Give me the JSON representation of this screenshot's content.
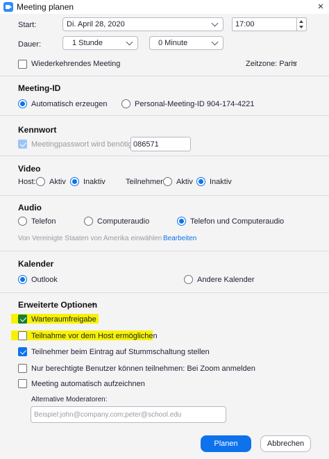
{
  "window": {
    "title": "Meeting planen",
    "close": "×"
  },
  "start": {
    "label": "Start:",
    "date": "Di.  April 28, 2020",
    "time": "17:00"
  },
  "duration": {
    "label": "Dauer:",
    "hours": "1 Stunde",
    "minutes": "0 Minute"
  },
  "recurring": {
    "label": "Wiederkehrendes Meeting",
    "checked": false
  },
  "timezone": {
    "label": "Zeitzone: Paris"
  },
  "meeting_id": {
    "title": "Meeting-ID",
    "auto": "Automatisch erzeugen",
    "personal": "Personal-Meeting-ID 904-174-4221",
    "selected": "auto"
  },
  "password": {
    "title": "Kennwort",
    "required_label": "Meetingpasswort wird benötigt",
    "value": "086571"
  },
  "video": {
    "title": "Video",
    "host_label": "Host:",
    "participants_label": "Teilnehmer:",
    "on": "Aktiv",
    "off": "Inaktiv",
    "host_selected": "off",
    "participants_selected": "off"
  },
  "audio": {
    "title": "Audio",
    "phone": "Telefon",
    "computer": "Computeraudio",
    "both": "Telefon und Computeraudio",
    "selected": "both",
    "dial_in_text": "Von Vereinigte Staaten von Amerika einwählen",
    "edit_link": "Bearbeiten"
  },
  "calendar": {
    "title": "Kalender",
    "outlook": "Outlook",
    "other": "Andere Kalender",
    "selected": "outlook"
  },
  "advanced": {
    "title": "Erweiterte Optionen",
    "caret": "^",
    "options": [
      {
        "label": "Warteraumfreigabe",
        "checked": true
      },
      {
        "label": "Teilnahme vor dem Host ermöglichen",
        "checked": false
      },
      {
        "label": "Teilnehmer beim Eintrag auf Stummschaltung stellen",
        "checked": true
      },
      {
        "label": "Nur berechtigte Benutzer können teilnehmen: Bei Zoom anmelden",
        "checked": false
      },
      {
        "label": "Meeting automatisch aufzeichnen",
        "checked": false
      }
    ],
    "alt_hosts_label": "Alternative Moderatoren:",
    "alt_hosts_placeholder": "Beispiel:john@company.com;peter@school.edu"
  },
  "buttons": {
    "schedule": "Planen",
    "cancel": "Abbrechen"
  },
  "colors": {
    "accent": "#0e72ed",
    "highlight": "#f7f300",
    "checkbox_green": "#1a7f37"
  }
}
